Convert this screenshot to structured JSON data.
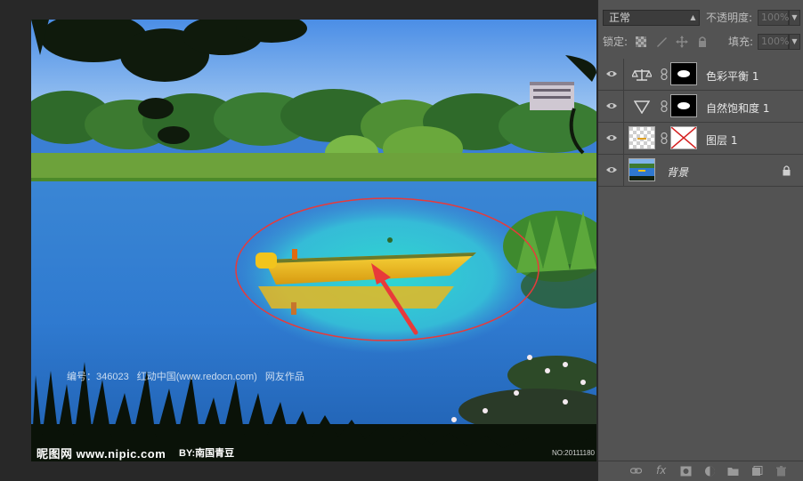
{
  "layers_panel": {
    "blend_mode": "正常",
    "opacity_label": "不透明度:",
    "opacity_value": "100%",
    "lock_label": "锁定:",
    "fill_label": "填充:",
    "fill_value": "100%",
    "layers": [
      {
        "name": "色彩平衡 1",
        "type": "adjustment",
        "icon": "balance-scale-icon"
      },
      {
        "name": "自然饱和度 1",
        "type": "adjustment",
        "icon": "vibrance-triangle-icon"
      },
      {
        "name": "图层 1",
        "type": "pixel"
      },
      {
        "name": "背景",
        "type": "background",
        "locked": true
      }
    ],
    "footer_icons": [
      "link-icon",
      "fx-icon",
      "mask-icon",
      "adjustment-icon",
      "folder-icon",
      "new-layer-icon",
      "trash-icon"
    ]
  },
  "canvas": {
    "watermark_info": "编号：346023  红动中国(www.redocn.com)  网友作品",
    "watermark_logo": "昵图网 www.nipic.com",
    "watermark_author": "BY:南国青豆",
    "watermark_id": "NO:20111180"
  },
  "colors": {
    "panel_bg": "#535353",
    "workspace_bg": "#282828",
    "annotation_red": "#e83a3a",
    "boat_yellow": "#f2c41c"
  }
}
